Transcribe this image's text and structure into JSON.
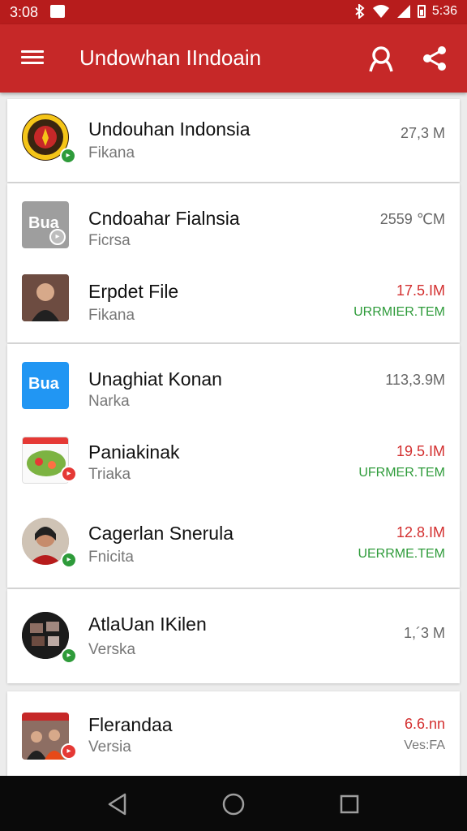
{
  "status_bar": {
    "time": "3:08",
    "right_time": "5:36"
  },
  "app_bar": {
    "title": "Undowhan IIndoain"
  },
  "items": [
    {
      "name": "Undouhan Indonsia",
      "subtitle": "Fikana",
      "size": "27,3 M",
      "status": ""
    },
    {
      "name": "Cndoahar Fialnsia",
      "subtitle": "Ficrsa",
      "size": "2559 ℃M",
      "status": ""
    },
    {
      "name": "Erpdet File",
      "subtitle": "Fikana",
      "size": "17.5.IM",
      "status": "URRMIER.TEM"
    },
    {
      "name": "Unaghiat Konan",
      "subtitle": "Narka",
      "size": "113,3.9M",
      "status": ""
    },
    {
      "name": "Paniakinak",
      "subtitle": "Triaka",
      "size": "19.5.IM",
      "status": "UFRMER.TEM"
    },
    {
      "name": "Cagerlan Snerula",
      "subtitle": "Fnicita",
      "size": "12.8.IM",
      "status": "UERRME.TEM"
    },
    {
      "name": "AtlaUan IKilen",
      "subtitle": "Verska",
      "size": "1,´3 M",
      "status": ""
    },
    {
      "name": "Flerandaa",
      "subtitle": "Versia",
      "size": "6.6.nn",
      "status": "Ves:FA"
    }
  ],
  "thumb_labels": {
    "app2": "Bua",
    "app4": "Bua"
  },
  "colors": {
    "primary": "#c62828",
    "status_bar": "#b71c1c",
    "accent_green": "#2e9b3a",
    "accent_red": "#d32f2f"
  },
  "icons": [
    "menu-icon",
    "search-icon",
    "share-icon",
    "back-icon",
    "home-icon",
    "recents-icon"
  ]
}
